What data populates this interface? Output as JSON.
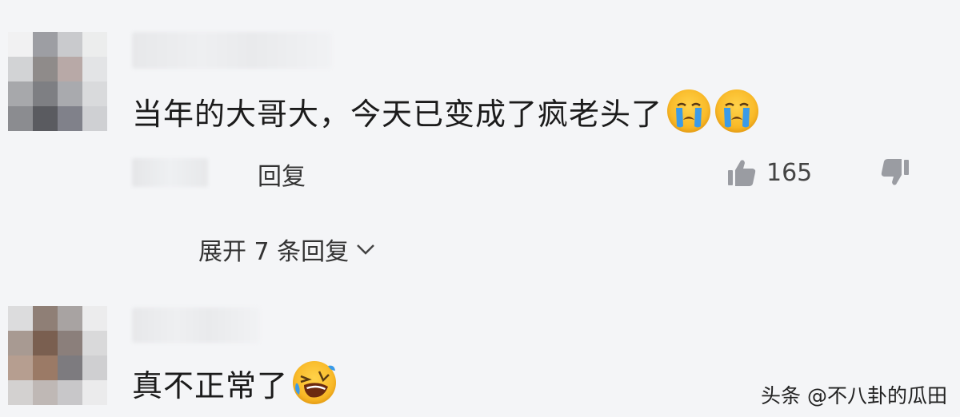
{
  "comments": [
    {
      "text": "当年的大哥大，今天已变成了疯老头了",
      "emojis": [
        "crying-emoji",
        "crying-emoji"
      ],
      "reply_label": "回复",
      "like_count": "165",
      "avatar_colors": [
        "#f1f1f2",
        "#9d9ea3",
        "#c9cacd",
        "#eceded",
        "#d2d3d5",
        "#8f8b8a",
        "#b8a9a7",
        "#e3e4e6",
        "#a7a8ab",
        "#7e7f83",
        "#a9aaae",
        "#d9dadc",
        "#8b8c90",
        "#5a5b60",
        "#80818a",
        "#cfd0d3"
      ]
    },
    {
      "text": "真不正常了",
      "emojis": [
        "laughing-emoji"
      ],
      "avatar_colors": [
        "#dcdcdd",
        "#8f7f76",
        "#a8a3a2",
        "#ececed",
        "#a89a92",
        "#7a5f50",
        "#8b7f7b",
        "#d9d9da",
        "#b69e90",
        "#9b7a66",
        "#7d7b7f",
        "#cfcfd1",
        "#d3d1d0",
        "#bfb8b5",
        "#c8c7c9",
        "#ebebec"
      ]
    }
  ],
  "expand_replies": "展开 7 条回复",
  "watermark": "头条 @不八卦的瓜田",
  "colors": {
    "background": "#f4f5f7",
    "text": "#1b1b1b",
    "secondary_text": "#333333",
    "emoji_yellow": "#f7b21e",
    "tear_blue": "#3b9be8"
  }
}
